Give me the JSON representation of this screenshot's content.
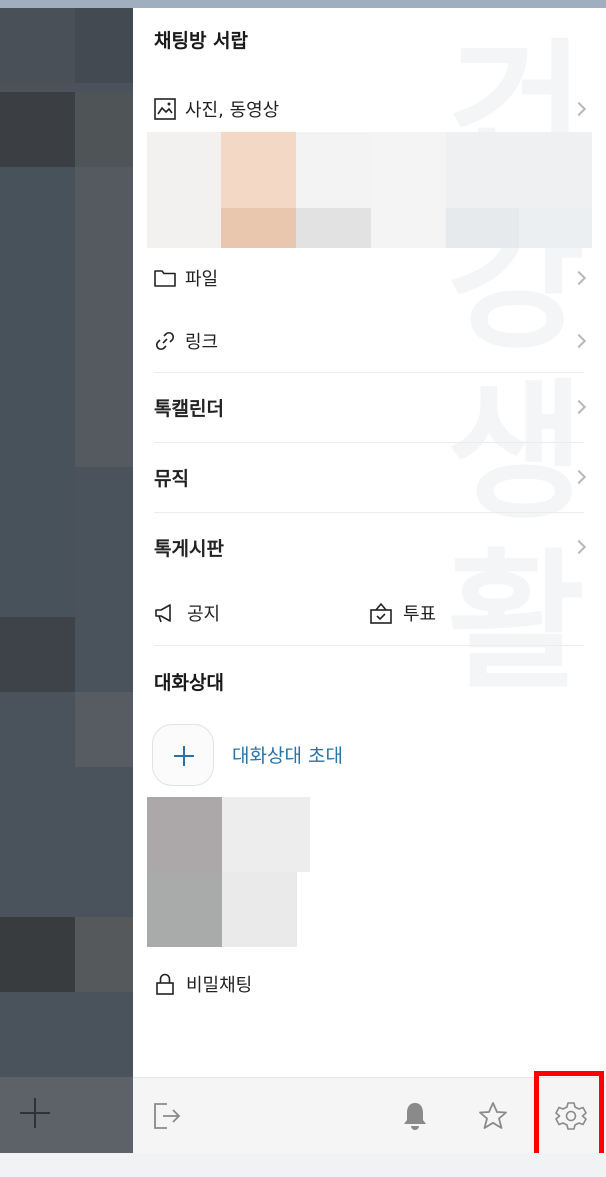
{
  "drawer": {
    "title": "채팅방 서랍",
    "watermark": "건강생활",
    "media": {
      "label": "사진, 동영상",
      "icon": "photo-icon"
    },
    "files": {
      "label": "파일",
      "icon": "folder-icon"
    },
    "links": {
      "label": "링크",
      "icon": "link-icon"
    },
    "calendar": {
      "label": "톡캘린더"
    },
    "music": {
      "label": "뮤직"
    },
    "board": {
      "label": "톡게시판"
    },
    "notice": {
      "label": "공지",
      "icon": "megaphone-icon"
    },
    "vote": {
      "label": "투표",
      "icon": "ballot-box-icon"
    },
    "members": {
      "title": "대화상대",
      "invite_label": "대화상대 초대"
    },
    "secret_chat": {
      "label": "비밀채팅",
      "icon": "lock-icon"
    }
  },
  "toolbar": {
    "exit_icon": "exit-icon",
    "bell_icon": "bell-icon",
    "star_icon": "star-icon",
    "settings_icon": "gear-icon"
  },
  "colors": {
    "accent": "#2a74a5",
    "highlight": "#ff0000"
  }
}
